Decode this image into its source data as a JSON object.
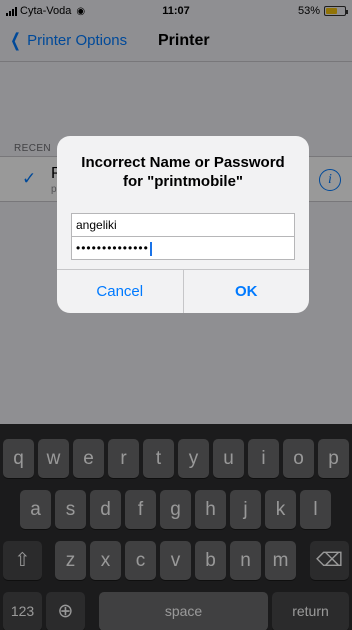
{
  "status_bar": {
    "carrier": "Cyta-Voda",
    "time": "11:07",
    "battery": "53%"
  },
  "nav": {
    "back_label": "Printer Options",
    "title": "Printer"
  },
  "section_header": "RECEN",
  "printer_row": {
    "title": "P",
    "subtitle": "p"
  },
  "alert": {
    "title_line1": "Incorrect Name or Password",
    "title_line2": "for \"printmobile\"",
    "username": "angeliki",
    "password_mask": "••••••••••••••",
    "cancel_label": "Cancel",
    "ok_label": "OK"
  },
  "keyboard": {
    "row1": [
      "q",
      "w",
      "e",
      "r",
      "t",
      "y",
      "u",
      "i",
      "o",
      "p"
    ],
    "row2": [
      "a",
      "s",
      "d",
      "f",
      "g",
      "h",
      "j",
      "k",
      "l"
    ],
    "row3": [
      "z",
      "x",
      "c",
      "v",
      "b",
      "n",
      "m"
    ],
    "numbers_label": "123",
    "space_label": "space",
    "return_label": "return"
  },
  "colors": {
    "accent": "#007aff",
    "battery": "#f4c20d"
  }
}
